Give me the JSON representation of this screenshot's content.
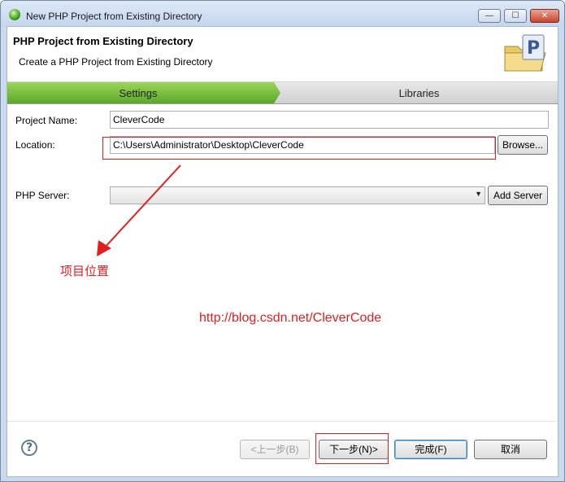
{
  "window": {
    "title": "New PHP Project from Existing Directory",
    "min_glyph": "—",
    "max_glyph": "☐",
    "close_glyph": "✕"
  },
  "banner": {
    "title": "PHP Project from Existing Directory",
    "description": "Create a PHP Project from Existing Directory",
    "icon": "php-folder-icon"
  },
  "steps": [
    {
      "label": "Settings",
      "active": true
    },
    {
      "label": "Libraries",
      "active": false
    }
  ],
  "form": {
    "project_name_label": "Project Name:",
    "project_name_value": "CleverCode",
    "location_label": "Location:",
    "location_value": "C:\\Users\\Administrator\\Desktop\\CleverCode",
    "browse_label": "Browse...",
    "php_server_label": "PHP Server:",
    "php_server_value": "",
    "add_server_label": "Add Server"
  },
  "annotations": {
    "location_note": "项目位置",
    "watermark": "http://blog.csdn.net/CleverCode",
    "color": "#e02020"
  },
  "footer": {
    "help_glyph": "?",
    "back_label": "<上一步(B)",
    "next_label": "下一步(N)>",
    "finish_label": "完成(F)",
    "cancel_label": "取消"
  },
  "colors": {
    "step_active": "#7cc144",
    "titlebar": "#c9d9ee"
  }
}
